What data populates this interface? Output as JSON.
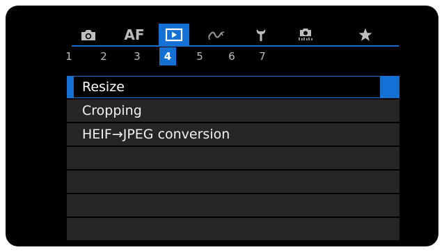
{
  "colors": {
    "accent": "#1470d2",
    "background": "#000000",
    "row": "#262626",
    "text": "#f2f2f2",
    "inactive": "#8c8c8c"
  },
  "tabs": [
    {
      "icon": "camera-icon",
      "label": ""
    },
    {
      "icon": "af-icon",
      "label": "AF"
    },
    {
      "icon": "playback-icon",
      "label": "",
      "active": true
    },
    {
      "icon": "wireless-icon",
      "label": ""
    },
    {
      "icon": "wrench-icon",
      "label": ""
    },
    {
      "icon": "custom-functions-icon",
      "label": ""
    },
    {
      "icon": "star-icon",
      "label": ""
    }
  ],
  "pages": [
    "1",
    "2",
    "3",
    "4",
    "5",
    "6",
    "7"
  ],
  "active_page": "4",
  "menu": {
    "items": [
      {
        "label": "Resize",
        "selected": true
      },
      {
        "label": "Cropping"
      },
      {
        "label": "HEIF→JPEG conversion"
      },
      {
        "label": ""
      },
      {
        "label": ""
      },
      {
        "label": ""
      },
      {
        "label": ""
      }
    ]
  }
}
